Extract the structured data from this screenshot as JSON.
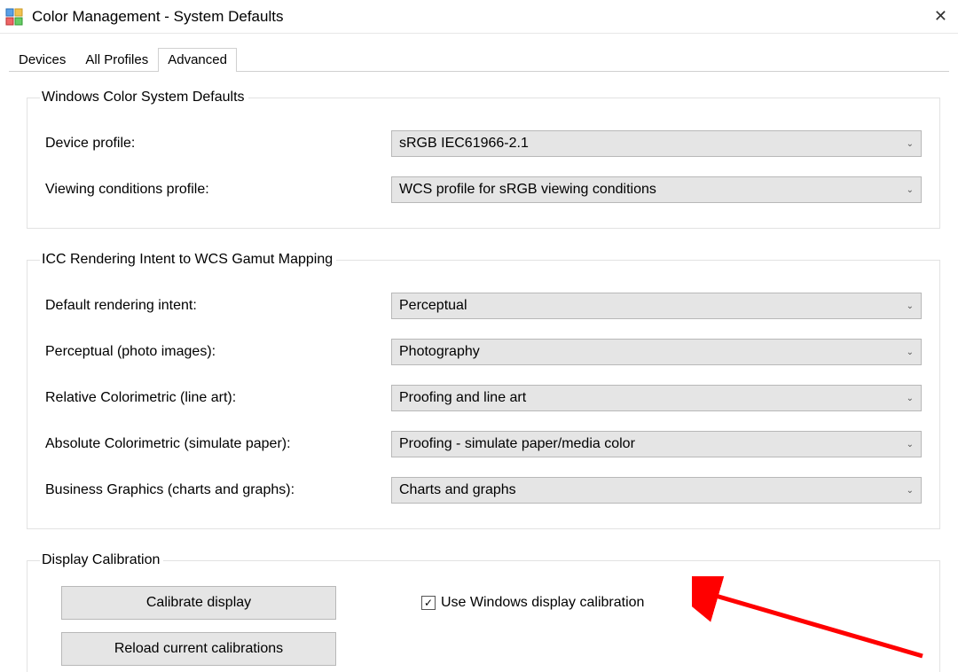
{
  "window": {
    "title": "Color Management - System Defaults"
  },
  "tabs": {
    "devices": "Devices",
    "all_profiles": "All Profiles",
    "advanced": "Advanced"
  },
  "group_wcs": {
    "legend": "Windows Color System Defaults",
    "device_profile_label": "Device profile:",
    "device_profile_value": "sRGB IEC61966-2.1",
    "viewing_label": "Viewing conditions profile:",
    "viewing_value": "WCS profile for sRGB viewing conditions"
  },
  "group_icc": {
    "legend": "ICC Rendering Intent to WCS Gamut Mapping",
    "default_intent_label": "Default rendering intent:",
    "default_intent_value": "Perceptual",
    "perceptual_label": "Perceptual (photo images):",
    "perceptual_value": "Photography",
    "relative_label": "Relative Colorimetric (line art):",
    "relative_value": "Proofing and line art",
    "absolute_label": "Absolute Colorimetric (simulate paper):",
    "absolute_value": "Proofing - simulate paper/media color",
    "business_label": "Business Graphics (charts and graphs):",
    "business_value": "Charts and graphs"
  },
  "group_calib": {
    "legend": "Display Calibration",
    "calibrate_btn": "Calibrate display",
    "reload_btn": "Reload current calibrations",
    "use_checkbox_label": "Use Windows display calibration",
    "use_checkbox_checked": true
  },
  "annotation": {
    "arrow_color": "#ff0000"
  }
}
